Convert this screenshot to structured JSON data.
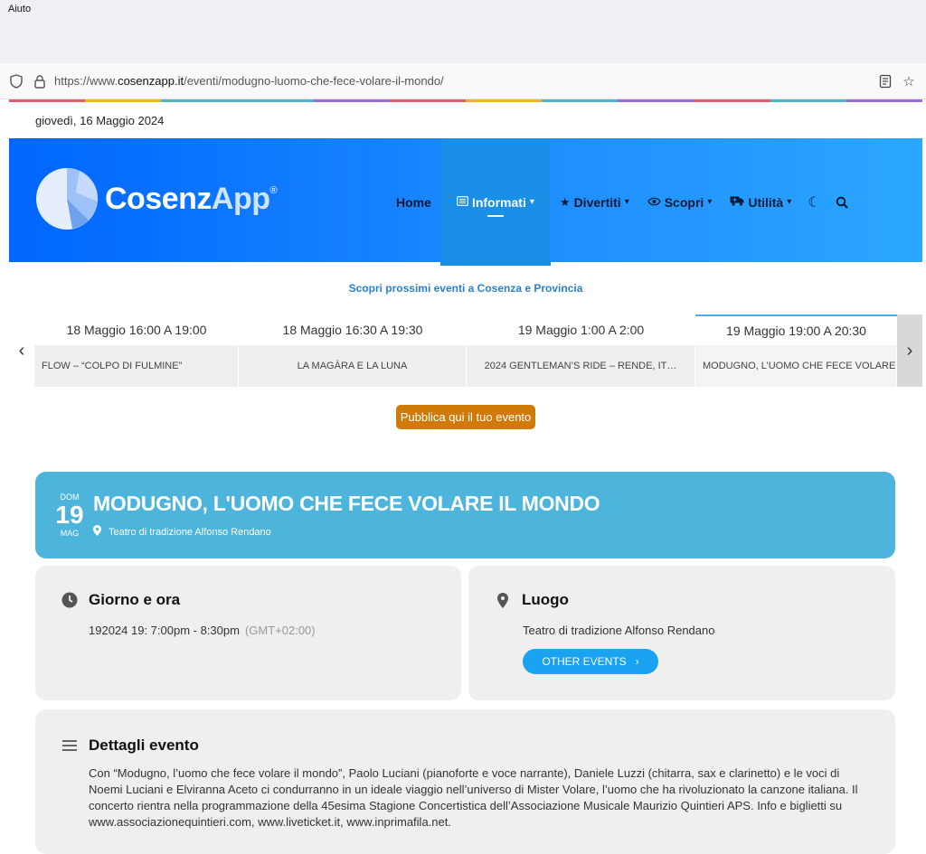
{
  "browser": {
    "menu_item": "Aiuto",
    "url_prefix": "https://www.",
    "url_domain": "cosenzapp.it",
    "url_path": "/eventi/modugno-luomo-che-fece-volare-il-mondo/"
  },
  "rainbow_colors": [
    "#e35d6a",
    "#f0b429",
    "#4cb8c4",
    "#4cb8c4",
    "#9b6bd6",
    "#e35d6a",
    "#f0b429",
    "#4cb8c4",
    "#9b6bd6",
    "#e35d6a",
    "#4cb8c4",
    "#9b6bd6"
  ],
  "site": {
    "date": "giovedì, 16 Maggio 2024",
    "logo_main": "Cosenz",
    "logo_app": "App",
    "logo_reg": "®"
  },
  "nav": {
    "home": "Home",
    "informati": "Informati",
    "divertiti": "Divertiti",
    "scopri": "Scopri",
    "utilita": "Utilità"
  },
  "events_bar": {
    "subtitle": "Scopri prossimi eventi a Cosenza e Provincia",
    "items": [
      {
        "date": "18 Maggio 16:00 A 19:00",
        "title": "FLOW – “COLPO DI FULMINE”"
      },
      {
        "date": "18 Maggio 16:30 A 19:30",
        "title": "LA MAGÀRA E LA LUNA"
      },
      {
        "date": "19 Maggio 1:00 A 2:00",
        "title": "2024 GENTLEMAN’S RIDE – RENDE, IT…"
      },
      {
        "date": "19 Maggio 19:00 A 20:30",
        "title": "MODUGNO, L’UOMO CHE FECE VOLARE IL MONDO"
      }
    ],
    "publish_label": "Pubblica qui il tuo evento"
  },
  "event": {
    "dow": "DOM",
    "day": "19",
    "month": "MAG",
    "title": "MODUGNO, L'UOMO CHE FECE VOLARE IL MONDO",
    "location": "Teatro di tradizione Alfonso Rendano"
  },
  "when": {
    "title": "Giorno e ora",
    "time": "192024 19: 7:00pm - 8:30pm",
    "tz": "(GMT+02:00)"
  },
  "where": {
    "title": "Luogo",
    "place": "Teatro di tradizione Alfonso Rendano",
    "button": "OTHER EVENTS"
  },
  "details": {
    "title": "Dettagli evento",
    "text": "Con “Modugno, l’uomo che fece volare il mondo”, Paolo Luciani (pianoforte e voce narrante), Daniele Luzzi (chitarra, sax e clarinetto) e le voci di Noemi Luciani e Elviranna Aceto ci condurranno in un ideale viaggio nell’universo di Mister Volare, l’uomo che ha rivoluzionato la canzone italiana. Il concerto rientra nella programmazione della 45esima Stagione Concertistica dell’Associazione Musicale Maurizio Quintieri APS. Info e biglietti su www.associazionequintieri.com, www.liveticket.it, www.inprimafila.net."
  }
}
